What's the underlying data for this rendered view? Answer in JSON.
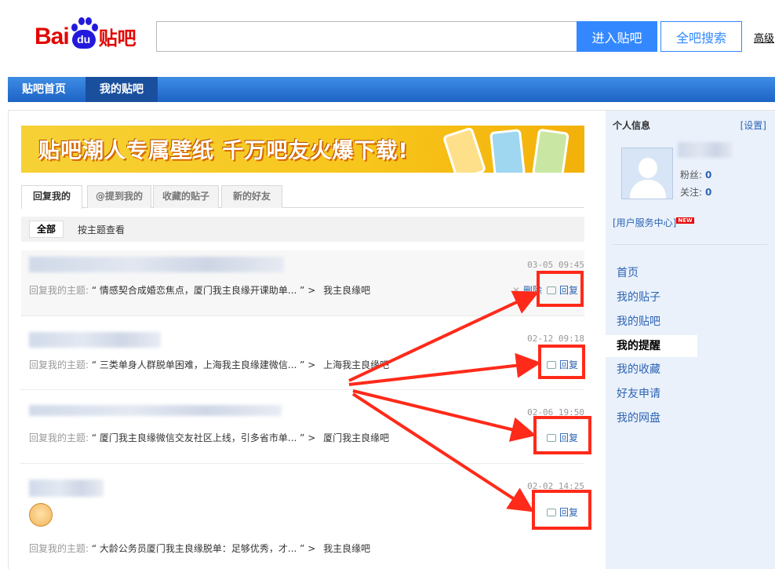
{
  "header": {
    "logo_bai": "Bai",
    "logo_du": "du",
    "logo_tieba": "贴吧",
    "search_placeholder": "",
    "enter_button": "进入贴吧",
    "search_all_button": "全吧搜索",
    "advanced_link": "高级"
  },
  "nav": {
    "home": "贴吧首页",
    "mine": "我的贴吧"
  },
  "banner": {
    "text": "贴吧潮人专属壁纸 千万吧友火爆下载!"
  },
  "tabs": [
    {
      "label": "回复我的",
      "active": true
    },
    {
      "label": "@提到我的",
      "active": false
    },
    {
      "label": "收藏的贴子",
      "active": false
    },
    {
      "label": "新的好友",
      "active": false
    }
  ],
  "subbar": {
    "all": "全部",
    "by_topic": "按主题查看"
  },
  "replies": [
    {
      "time": "03-05 09:45",
      "prefix": "回复我的主题:",
      "topic": "“ 情感契合成婚恋焦点，厦门我主良缘开课助单... ”",
      "arrow": ">",
      "bar": "我主良缘吧",
      "delete": "删除",
      "reply": "回复"
    },
    {
      "time": "02-12 09:18",
      "prefix": "回复我的主题:",
      "topic": "“ 三类单身人群脱单困难，上海我主良缘建微信... ”",
      "arrow": ">",
      "bar": "上海我主良缘吧",
      "reply": "回复"
    },
    {
      "time": "02-06 19:50",
      "prefix": "回复我的主题:",
      "topic": "“ 厦门我主良缘微信交友社区上线，引多省市单... ”",
      "arrow": ">",
      "bar": "厦门我主良缘吧",
      "reply": "回复"
    },
    {
      "time": "02-02 14:25",
      "prefix": "回复我的主题:",
      "topic": "“ 大龄公务员厦门我主良缘脱单：足够优秀，才... ”",
      "arrow": ">",
      "bar": "我主良缘吧",
      "reply": "回复"
    }
  ],
  "sidebar": {
    "title": "个人信息",
    "settings": "[设置]",
    "fans_label": "粉丝:",
    "fans_value": "0",
    "follow_label": "关注:",
    "follow_value": "0",
    "service_center": "[用户服务中心]",
    "new_badge": "NEW",
    "menu": [
      {
        "label": "首页",
        "active": false
      },
      {
        "label": "我的贴子",
        "active": false
      },
      {
        "label": "我的贴吧",
        "active": false
      },
      {
        "label": "我的提醒",
        "active": true
      },
      {
        "label": "我的收藏",
        "active": false
      },
      {
        "label": "好友申请",
        "active": false
      },
      {
        "label": "我的网盘",
        "active": false
      }
    ]
  },
  "colors": {
    "brand_red": "#e10601",
    "brand_blue": "#3388ff",
    "nav_blue": "#1e63c4",
    "link_blue": "#2d64b3",
    "annotation_red": "#ff2a1a"
  }
}
